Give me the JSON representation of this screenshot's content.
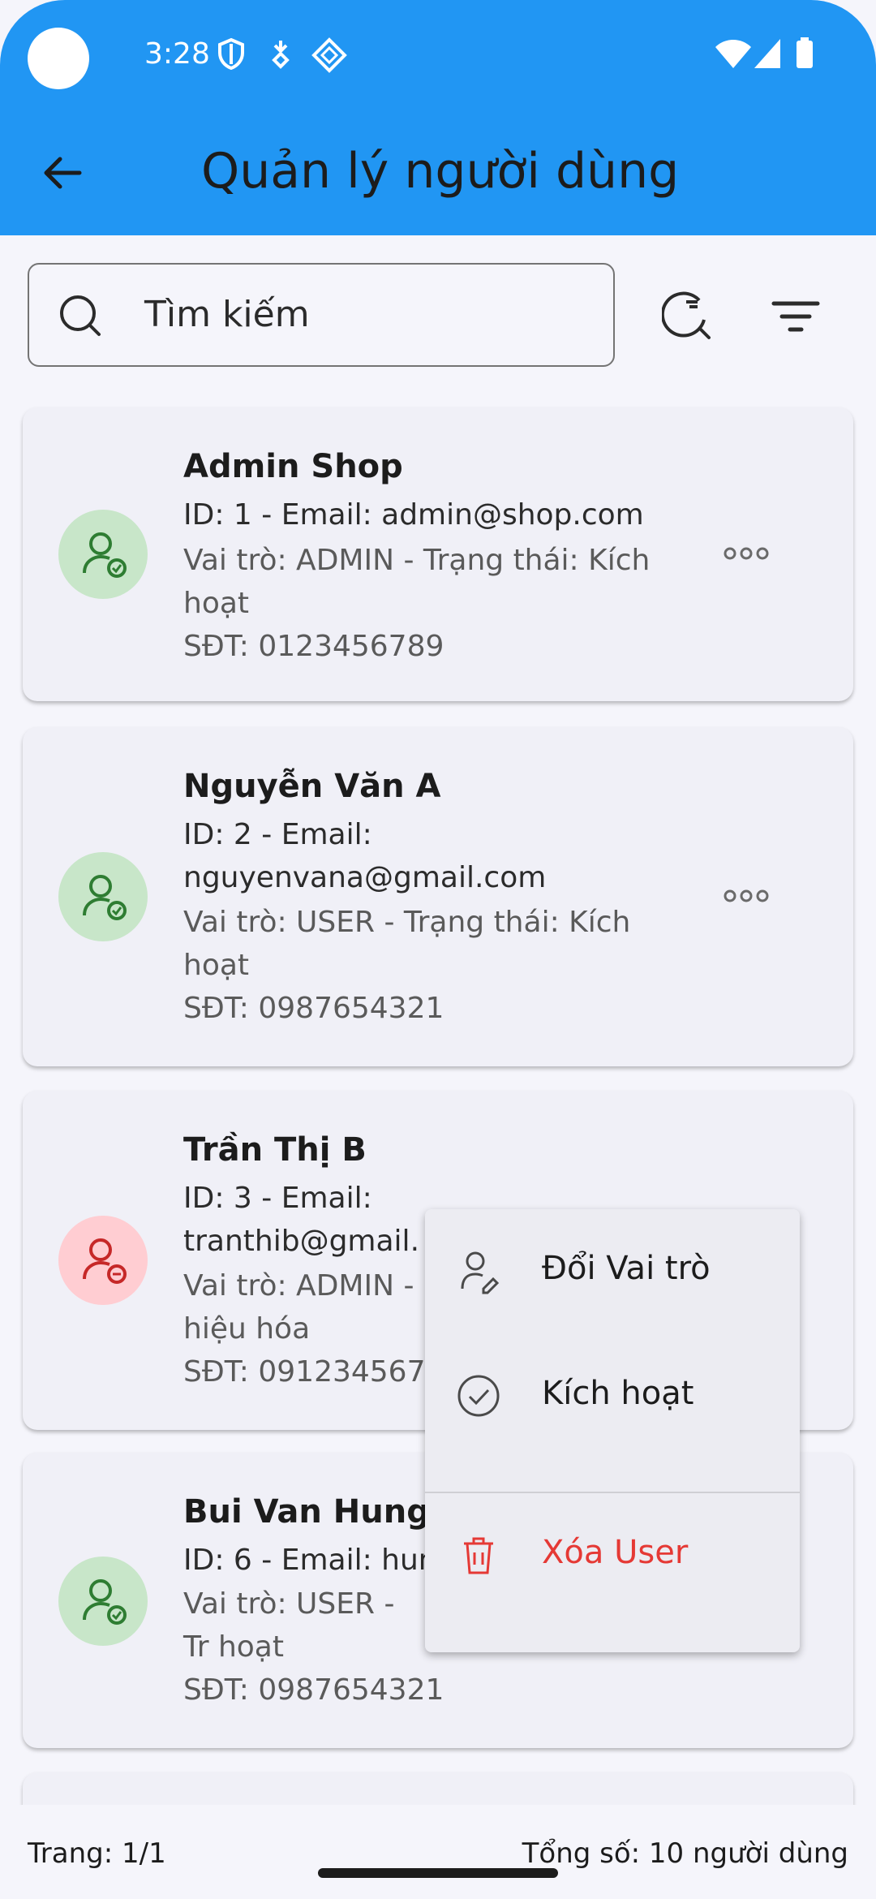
{
  "status_bar": {
    "time": "3:28"
  },
  "header": {
    "title": "Quản lý người dùng"
  },
  "search": {
    "placeholder": "Tìm kiếm"
  },
  "users": [
    {
      "name": "Admin Shop",
      "line1": "ID: 1 - Email: admin@shop.com",
      "line2": "Vai trò: ADMIN - Trạng thái: Kích hoạt",
      "line3": "SĐT: 0123456789",
      "status": "active"
    },
    {
      "name": "Nguyễn Văn A",
      "line1": "ID: 2 - Email: nguyenvana@gmail.com",
      "line2": "Vai trò: USER - Trạng thái: Kích hoạt",
      "line3": "SĐT: 0987654321",
      "status": "active"
    },
    {
      "name": "Trần Thị B",
      "line1": "ID: 3 - Email: tranthib@gmail.",
      "line2": "Vai trò: ADMIN - hiệu hóa",
      "line3": "SĐT: 0912345678",
      "status": "inactive"
    },
    {
      "name": "Bui Van Hung",
      "line1": "ID: 6 - Email: hun",
      "line2": "Vai trò: USER - Tr hoạt",
      "line3": "SĐT: 0987654321",
      "status": "active"
    }
  ],
  "context_menu": {
    "items": [
      {
        "label": "Đổi Vai trò",
        "icon": "user-edit-icon"
      },
      {
        "label": "Kích hoạt",
        "icon": "check-circle-icon"
      },
      {
        "label": "Xóa User",
        "icon": "trash-icon"
      }
    ]
  },
  "footer": {
    "page": "Trang: 1/1",
    "total": "Tổng số: 10 người dùng"
  },
  "colors": {
    "primary": "#2196F3",
    "danger": "#E53935",
    "active_avatar": "#C8E6C9",
    "inactive_avatar": "#FFCDD2"
  }
}
